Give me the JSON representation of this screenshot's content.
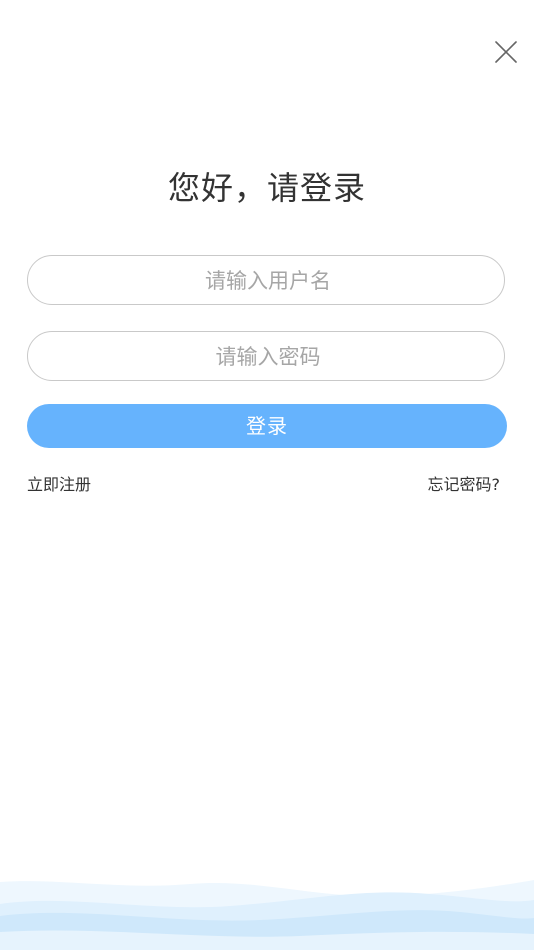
{
  "header": {
    "close_icon": "close-icon"
  },
  "title": "您好，请登录",
  "form": {
    "username_placeholder": "请输入用户名",
    "username_value": "",
    "password_placeholder": "请输入密码",
    "password_value": "",
    "login_label": "登录"
  },
  "links": {
    "register": "立即注册",
    "forgot": "忘记密码?"
  },
  "colors": {
    "accent": "#66b3fd",
    "title_text": "#333333",
    "placeholder": "#a6a6a6",
    "border": "#c9c9c9",
    "wave": "#d6ecfb"
  }
}
